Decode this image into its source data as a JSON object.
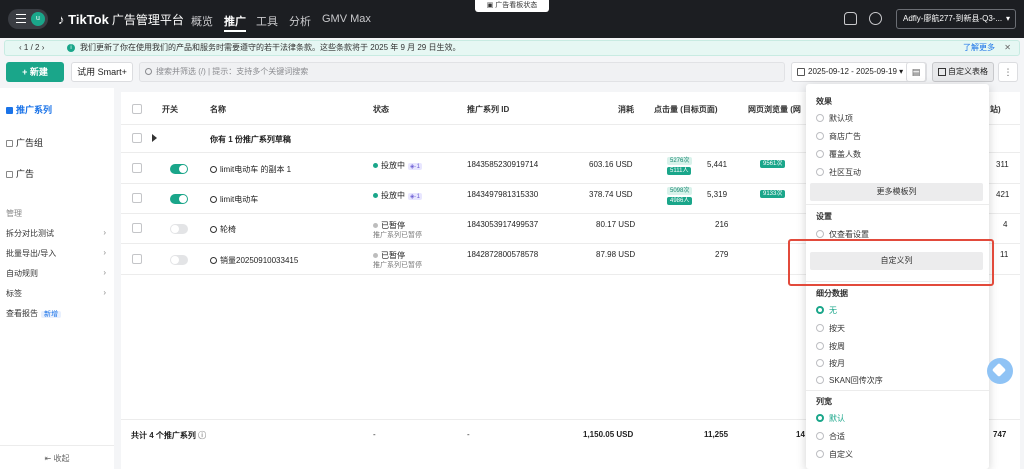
{
  "topbar": {
    "avatar": "u",
    "brand": "TikTok",
    "brand_sub": "广告管理平台",
    "nav": [
      "概览",
      "推广",
      "工具",
      "分析",
      "GMV Max"
    ],
    "status_pill": "广告看板状态",
    "account": "Adfly-廖航277-到新县-Q3-..."
  },
  "notice": {
    "page": "1 / 2",
    "text": "我们更新了你在使用我们的产品和服务时需要遵守的若干法律条款。这些条款将于 2025 年 9 月 29 日生效。",
    "more": "了解更多"
  },
  "toolbar": {
    "new_label": "+ 新建",
    "smart_label": "试用 Smart+",
    "search_placeholder": "搜索并筛选 (/) | 提示：支持多个关键词搜索",
    "date_range": "2025-09-12 - 2025-09-19",
    "custom_table_label": "自定义表格"
  },
  "sidebar": {
    "items": [
      "推广系列",
      "广告组",
      "广告"
    ],
    "section_label": "管理",
    "links": [
      "拆分对比测试",
      "批量导出/导入",
      "自动规则",
      "标签"
    ],
    "report_label": "查看报告",
    "report_badge": "新增",
    "collapse_label": "收起"
  },
  "table": {
    "headers": [
      "开关",
      "名称",
      "状态",
      "推广系列 ID",
      "消耗",
      "点击量 (目标页面)",
      "网页浏览量 (网",
      "站)"
    ],
    "draft_row": "你有 1 份推广系列草稿",
    "rows": [
      {
        "name": "limit电动车 的副本 1",
        "status": "投放中",
        "badge": "1",
        "status_sub": "",
        "id": "1843585230919714",
        "spend": "603.16 USD",
        "chip1": "5276次",
        "chip2": "5111人",
        "clicks": "5,441",
        "view_chip": "9561次",
        "right": "311",
        "on": true
      },
      {
        "name": "limit电动车",
        "status": "投放中",
        "badge": "1",
        "status_sub": "",
        "id": "1843497981315330",
        "spend": "378.74 USD",
        "chip1": "5098次",
        "chip2": "4986人",
        "clicks": "5,319",
        "view_chip": "9133次",
        "right": "421",
        "on": true
      },
      {
        "name": "轮椅",
        "status": "已暂停",
        "badge": "",
        "status_sub": "推广系列已暂停",
        "id": "1843053917499537",
        "spend": "80.17 USD",
        "chip1": "",
        "chip2": "",
        "clicks": "216",
        "view_chip": "",
        "right": "4",
        "on": false
      },
      {
        "name": "销量20250910033415",
        "status": "已暂停",
        "badge": "",
        "status_sub": "推广系列已暂停",
        "id": "1842872800578578",
        "spend": "87.98 USD",
        "chip1": "",
        "chip2": "",
        "clicks": "279",
        "view_chip": "",
        "right": "11",
        "on": false
      }
    ],
    "footer": {
      "label": "共计 4 个推广系列",
      "status": "-",
      "id": "-",
      "spend": "1,150.05 USD",
      "clicks": "11,255",
      "partial": "14",
      "right": "747"
    }
  },
  "dropdown": {
    "section_effect": "效果",
    "effect_options": [
      "默认项",
      "商店广告",
      "覆盖人数",
      "社区互动"
    ],
    "more_templates": "更多模板列",
    "section_settings": "设置",
    "view_settings": "仅查看设置",
    "custom_columns": "自定义列",
    "section_breakdown": "细分数据",
    "breakdown_options": [
      "无",
      "按天",
      "按周",
      "按月",
      "SKAN回传次序"
    ],
    "section_width": "列宽",
    "width_options": [
      "默认",
      "合适",
      "自定义"
    ]
  },
  "colors": {
    "accent": "#1aa68a",
    "highlight": "#e24a3b",
    "topbar": "#1c1e22"
  }
}
